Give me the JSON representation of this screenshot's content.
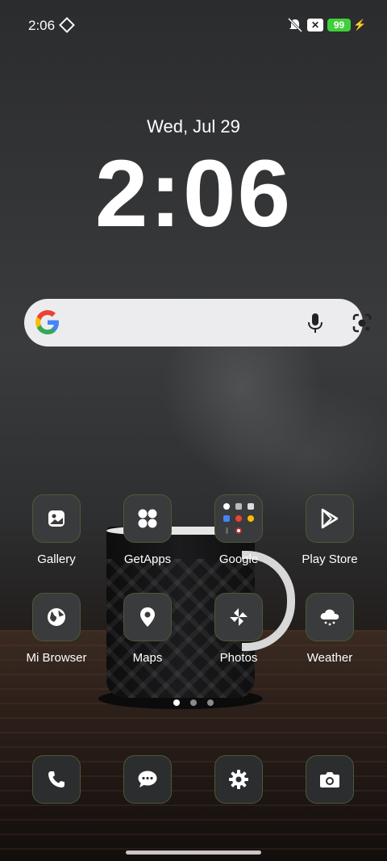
{
  "status_bar": {
    "time": "2:06",
    "icons": [
      "sync-icon",
      "mute-vibrate-icon",
      "x-notification-icon",
      "charging-bolt-icon"
    ],
    "battery_level": "99",
    "battery_color": "#3fcf3a"
  },
  "clock_widget": {
    "date": "Wed, Jul 29",
    "time": "2:06"
  },
  "search_bar": {
    "icons": [
      "google-logo-icon",
      "mic-icon",
      "google-lens-icon"
    ]
  },
  "apps": {
    "row1": [
      {
        "label": "Gallery",
        "icon": "gallery-icon"
      },
      {
        "label": "GetApps",
        "icon": "getapps-icon"
      },
      {
        "label": "Google",
        "icon": "google-folder-icon"
      },
      {
        "label": "Play Store",
        "icon": "play-store-icon"
      }
    ],
    "row2": [
      {
        "label": "Mi Browser",
        "icon": "globe-icon"
      },
      {
        "label": "Maps",
        "icon": "map-pin-icon"
      },
      {
        "label": "Photos",
        "icon": "pinwheel-icon"
      },
      {
        "label": "Weather",
        "icon": "weather-icon"
      }
    ]
  },
  "page_indicator": {
    "pages": 3,
    "active": 1
  },
  "dock": [
    {
      "icon": "phone-icon"
    },
    {
      "icon": "messages-icon"
    },
    {
      "icon": "settings-gear-icon"
    },
    {
      "icon": "camera-icon"
    }
  ],
  "theme": {
    "tile_border": "#4b5a35",
    "tile_bg": "#3a3b3c"
  }
}
